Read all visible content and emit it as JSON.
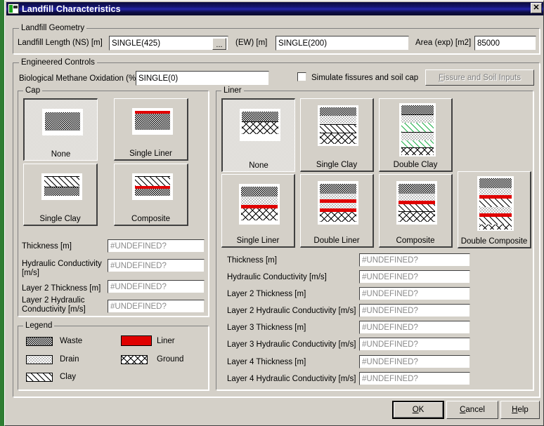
{
  "window": {
    "title": "Landfill Characteristics",
    "close_label": "✕",
    "icon": "landfill-app-icon"
  },
  "geometry": {
    "legend": "Landfill Geometry",
    "length_ns_label": "Landfill Length (NS) [m]",
    "length_ns_value": "SINGLE(425)",
    "browse_label": "...",
    "ew_label": "(EW) [m]",
    "ew_value": "SINGLE(200)",
    "area_label": "Area (exp) [m2]",
    "area_value": "85000"
  },
  "engineered": {
    "legend": "Engineered Controls",
    "methane_label": "Biological Methane Oxidation (%)",
    "methane_value": "SINGLE(0)",
    "checkbox_label": "Simulate fissures and soil cap",
    "checkbox_checked": false,
    "fissure_button": "Fissure and Soil Inputs",
    "fissure_button_accel": "F",
    "fissure_button_disabled": true
  },
  "cap": {
    "legend": "Cap",
    "selected": "None",
    "tiles": [
      {
        "label": "None",
        "selected": true
      },
      {
        "label": "Single Liner",
        "selected": false
      },
      {
        "label": "Single Clay",
        "selected": false
      },
      {
        "label": "Composite",
        "selected": false
      }
    ],
    "fields": [
      {
        "label": "Thickness [m]",
        "value": "#UNDEFINED?"
      },
      {
        "label": "Hydraulic Conductivity [m/s]",
        "value": "#UNDEFINED?"
      },
      {
        "label": "Layer 2 Thickness [m]",
        "value": "#UNDEFINED?"
      },
      {
        "label": "Layer 2 Hydraulic Conductivity [m/s]",
        "value": "#UNDEFINED?"
      }
    ]
  },
  "liner": {
    "legend": "Liner",
    "selected": "None",
    "tiles": [
      {
        "label": "None",
        "selected": true
      },
      {
        "label": "Single Clay",
        "selected": false
      },
      {
        "label": "Double Clay",
        "selected": false
      },
      {
        "label": "Single Liner",
        "selected": false
      },
      {
        "label": "Double Liner",
        "selected": false
      },
      {
        "label": "Composite",
        "selected": false
      },
      {
        "label": "Double Composite",
        "selected": false
      }
    ],
    "fields": [
      {
        "label": "Thickness [m]",
        "value": "#UNDEFINED?"
      },
      {
        "label": "Hydraulic Conductivity [m/s]",
        "value": "#UNDEFINED?"
      },
      {
        "label": "Layer 2 Thickness [m]",
        "value": "#UNDEFINED?"
      },
      {
        "label": "Layer 2 Hydraulic Conductivity [m/s]",
        "value": "#UNDEFINED?"
      },
      {
        "label": "Layer 3 Thickness [m]",
        "value": "#UNDEFINED?"
      },
      {
        "label": "Layer 3 Hydraulic Conductivity [m/s]",
        "value": "#UNDEFINED?"
      },
      {
        "label": "Layer 4 Thickness [m]",
        "value": "#UNDEFINED?"
      },
      {
        "label": "Layer 4 Hydraulic Conductivity [m/s]",
        "value": "#UNDEFINED?"
      }
    ]
  },
  "legend_box": {
    "legend": "Legend",
    "items": [
      {
        "label": "Waste",
        "fill": "checker"
      },
      {
        "label": "Liner",
        "fill": "red"
      },
      {
        "label": "Drain",
        "fill": "dots"
      },
      {
        "label": "Ground",
        "fill": "cross-hatch"
      },
      {
        "label": "Clay",
        "fill": "diagonal"
      }
    ]
  },
  "buttons": {
    "ok": "OK",
    "ok_accel": "O",
    "cancel": "Cancel",
    "cancel_accel": "C",
    "help": "Help",
    "help_accel": "H"
  },
  "colors": {
    "liner_red": "#e00000",
    "clay_green": "#22b14c",
    "face": "#d4d0c8",
    "title_blue": "#14146e"
  }
}
